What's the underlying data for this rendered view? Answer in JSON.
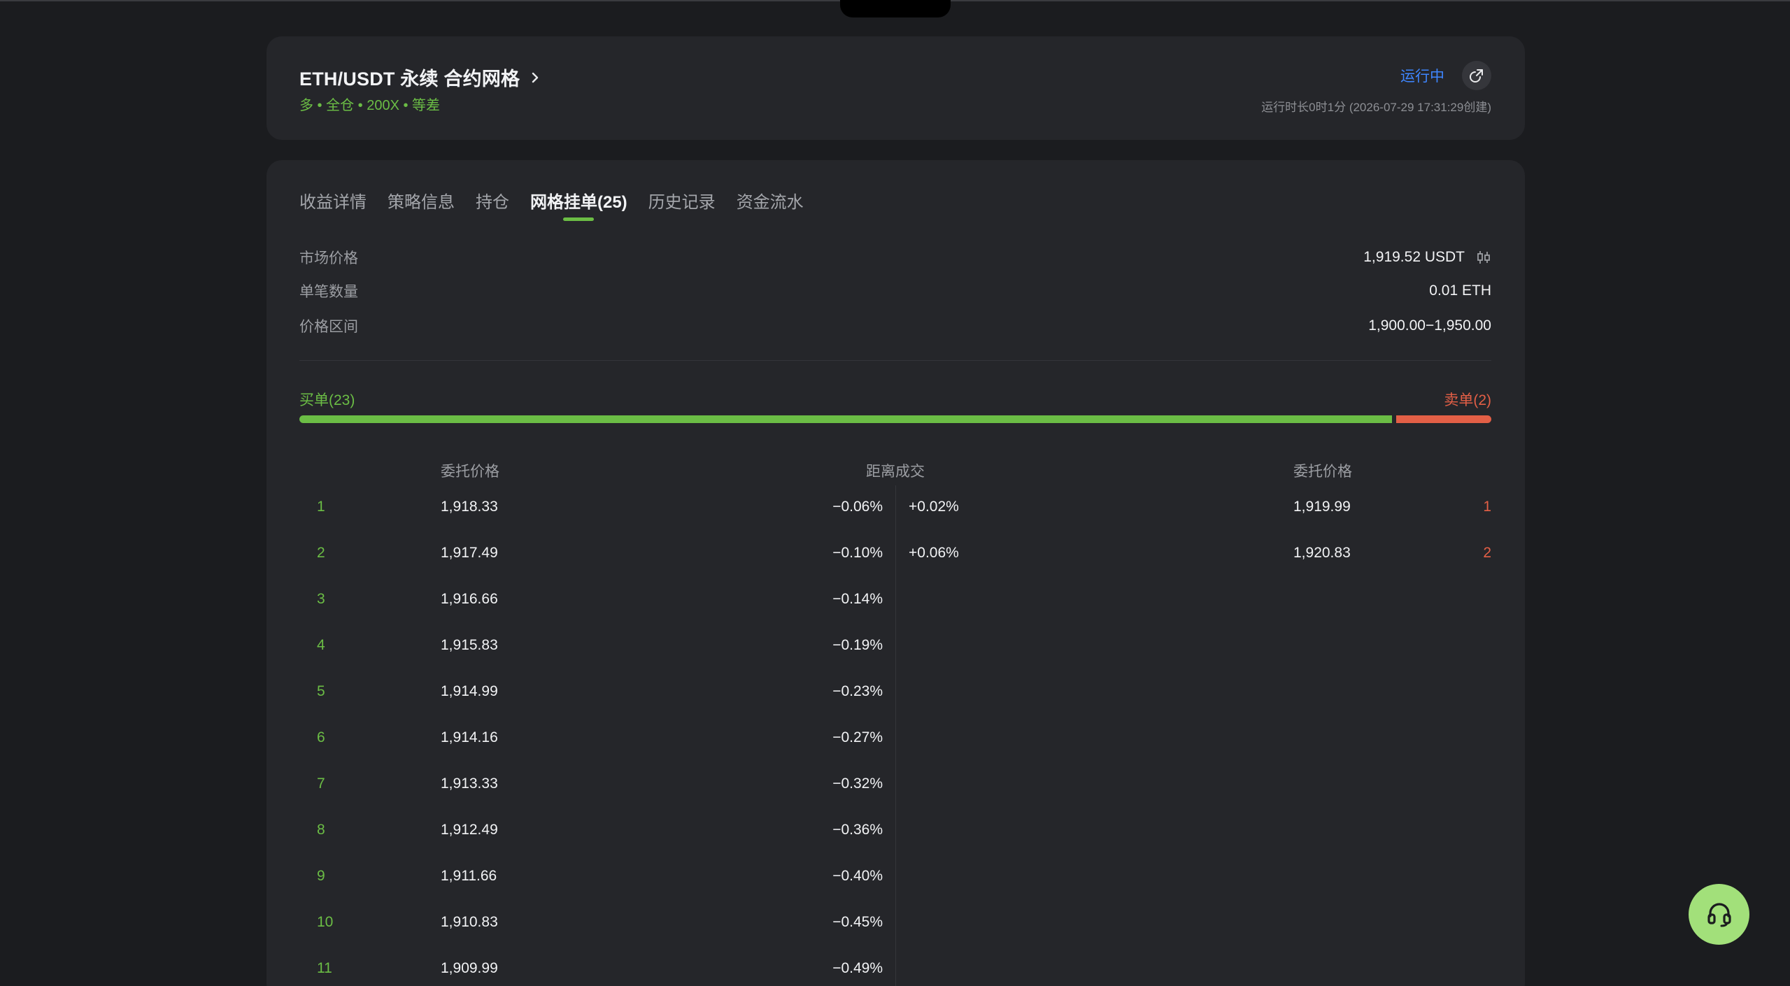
{
  "header": {
    "title": "ETH/USDT 永续 合约网格",
    "subtitle": "多 • 全仓 • 200X • 等差",
    "status": "运行中",
    "runtime": "运行时长0时1分 (2026-07-29 17:31:29创建)"
  },
  "tabs": [
    {
      "label": "收益详情",
      "active": false
    },
    {
      "label": "策略信息",
      "active": false
    },
    {
      "label": "持仓",
      "active": false
    },
    {
      "label": "网格挂单(25)",
      "active": true
    },
    {
      "label": "历史记录",
      "active": false
    },
    {
      "label": "资金流水",
      "active": false
    }
  ],
  "info": {
    "market_price_label": "市场价格",
    "market_price_value": "1,919.52 USDT",
    "qty_label": "单笔数量",
    "qty_value": "0.01 ETH",
    "range_label": "价格区间",
    "range_value": "1,900.00−1,950.00"
  },
  "orders_summary": {
    "buy_label": "买单(23)",
    "sell_label": "卖单(2)",
    "buy_count": 23,
    "sell_count": 2
  },
  "columns": {
    "buy_price": "委托价格",
    "distance": "距离成交",
    "sell_price": "委托价格"
  },
  "buy_orders": [
    {
      "index": "1",
      "price": "1,918.33",
      "distance": "−0.06%"
    },
    {
      "index": "2",
      "price": "1,917.49",
      "distance": "−0.10%"
    },
    {
      "index": "3",
      "price": "1,916.66",
      "distance": "−0.14%"
    },
    {
      "index": "4",
      "price": "1,915.83",
      "distance": "−0.19%"
    },
    {
      "index": "5",
      "price": "1,914.99",
      "distance": "−0.23%"
    },
    {
      "index": "6",
      "price": "1,914.16",
      "distance": "−0.27%"
    },
    {
      "index": "7",
      "price": "1,913.33",
      "distance": "−0.32%"
    },
    {
      "index": "8",
      "price": "1,912.49",
      "distance": "−0.36%"
    },
    {
      "index": "9",
      "price": "1,911.66",
      "distance": "−0.40%"
    },
    {
      "index": "10",
      "price": "1,910.83",
      "distance": "−0.45%"
    },
    {
      "index": "11",
      "price": "1,909.99",
      "distance": "−0.49%"
    }
  ],
  "sell_orders": [
    {
      "index": "1",
      "price": "1,919.99",
      "distance": "+0.02%"
    },
    {
      "index": "2",
      "price": "1,920.83",
      "distance": "+0.06%"
    }
  ],
  "colors": {
    "buy": "#6bbd45",
    "sell": "#e35f46",
    "status": "#3e86ff",
    "support_button": "#a2e07a"
  },
  "icons": {
    "title_chevron": "chevron-right-icon",
    "share": "share-icon",
    "kline": "candlestick-icon",
    "support": "headset-icon"
  }
}
